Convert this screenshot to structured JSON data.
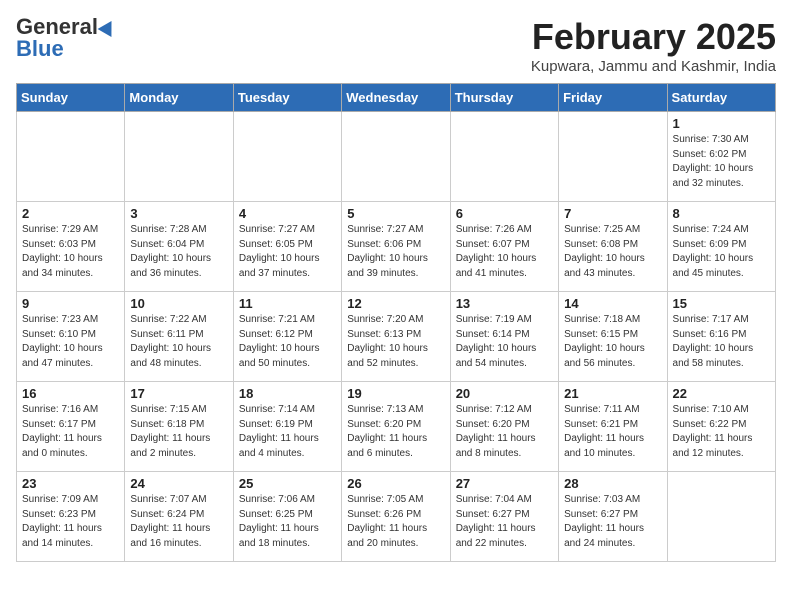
{
  "logo": {
    "general": "General",
    "blue": "Blue"
  },
  "title": "February 2025",
  "subtitle": "Kupwara, Jammu and Kashmir, India",
  "days_of_week": [
    "Sunday",
    "Monday",
    "Tuesday",
    "Wednesday",
    "Thursday",
    "Friday",
    "Saturday"
  ],
  "weeks": [
    [
      {
        "day": "",
        "info": ""
      },
      {
        "day": "",
        "info": ""
      },
      {
        "day": "",
        "info": ""
      },
      {
        "day": "",
        "info": ""
      },
      {
        "day": "",
        "info": ""
      },
      {
        "day": "",
        "info": ""
      },
      {
        "day": "1",
        "info": "Sunrise: 7:30 AM\nSunset: 6:02 PM\nDaylight: 10 hours and 32 minutes."
      }
    ],
    [
      {
        "day": "2",
        "info": "Sunrise: 7:29 AM\nSunset: 6:03 PM\nDaylight: 10 hours and 34 minutes."
      },
      {
        "day": "3",
        "info": "Sunrise: 7:28 AM\nSunset: 6:04 PM\nDaylight: 10 hours and 36 minutes."
      },
      {
        "day": "4",
        "info": "Sunrise: 7:27 AM\nSunset: 6:05 PM\nDaylight: 10 hours and 37 minutes."
      },
      {
        "day": "5",
        "info": "Sunrise: 7:27 AM\nSunset: 6:06 PM\nDaylight: 10 hours and 39 minutes."
      },
      {
        "day": "6",
        "info": "Sunrise: 7:26 AM\nSunset: 6:07 PM\nDaylight: 10 hours and 41 minutes."
      },
      {
        "day": "7",
        "info": "Sunrise: 7:25 AM\nSunset: 6:08 PM\nDaylight: 10 hours and 43 minutes."
      },
      {
        "day": "8",
        "info": "Sunrise: 7:24 AM\nSunset: 6:09 PM\nDaylight: 10 hours and 45 minutes."
      }
    ],
    [
      {
        "day": "9",
        "info": "Sunrise: 7:23 AM\nSunset: 6:10 PM\nDaylight: 10 hours and 47 minutes."
      },
      {
        "day": "10",
        "info": "Sunrise: 7:22 AM\nSunset: 6:11 PM\nDaylight: 10 hours and 48 minutes."
      },
      {
        "day": "11",
        "info": "Sunrise: 7:21 AM\nSunset: 6:12 PM\nDaylight: 10 hours and 50 minutes."
      },
      {
        "day": "12",
        "info": "Sunrise: 7:20 AM\nSunset: 6:13 PM\nDaylight: 10 hours and 52 minutes."
      },
      {
        "day": "13",
        "info": "Sunrise: 7:19 AM\nSunset: 6:14 PM\nDaylight: 10 hours and 54 minutes."
      },
      {
        "day": "14",
        "info": "Sunrise: 7:18 AM\nSunset: 6:15 PM\nDaylight: 10 hours and 56 minutes."
      },
      {
        "day": "15",
        "info": "Sunrise: 7:17 AM\nSunset: 6:16 PM\nDaylight: 10 hours and 58 minutes."
      }
    ],
    [
      {
        "day": "16",
        "info": "Sunrise: 7:16 AM\nSunset: 6:17 PM\nDaylight: 11 hours and 0 minutes."
      },
      {
        "day": "17",
        "info": "Sunrise: 7:15 AM\nSunset: 6:18 PM\nDaylight: 11 hours and 2 minutes."
      },
      {
        "day": "18",
        "info": "Sunrise: 7:14 AM\nSunset: 6:19 PM\nDaylight: 11 hours and 4 minutes."
      },
      {
        "day": "19",
        "info": "Sunrise: 7:13 AM\nSunset: 6:20 PM\nDaylight: 11 hours and 6 minutes."
      },
      {
        "day": "20",
        "info": "Sunrise: 7:12 AM\nSunset: 6:20 PM\nDaylight: 11 hours and 8 minutes."
      },
      {
        "day": "21",
        "info": "Sunrise: 7:11 AM\nSunset: 6:21 PM\nDaylight: 11 hours and 10 minutes."
      },
      {
        "day": "22",
        "info": "Sunrise: 7:10 AM\nSunset: 6:22 PM\nDaylight: 11 hours and 12 minutes."
      }
    ],
    [
      {
        "day": "23",
        "info": "Sunrise: 7:09 AM\nSunset: 6:23 PM\nDaylight: 11 hours and 14 minutes."
      },
      {
        "day": "24",
        "info": "Sunrise: 7:07 AM\nSunset: 6:24 PM\nDaylight: 11 hours and 16 minutes."
      },
      {
        "day": "25",
        "info": "Sunrise: 7:06 AM\nSunset: 6:25 PM\nDaylight: 11 hours and 18 minutes."
      },
      {
        "day": "26",
        "info": "Sunrise: 7:05 AM\nSunset: 6:26 PM\nDaylight: 11 hours and 20 minutes."
      },
      {
        "day": "27",
        "info": "Sunrise: 7:04 AM\nSunset: 6:27 PM\nDaylight: 11 hours and 22 minutes."
      },
      {
        "day": "28",
        "info": "Sunrise: 7:03 AM\nSunset: 6:27 PM\nDaylight: 11 hours and 24 minutes."
      },
      {
        "day": "",
        "info": ""
      }
    ]
  ]
}
